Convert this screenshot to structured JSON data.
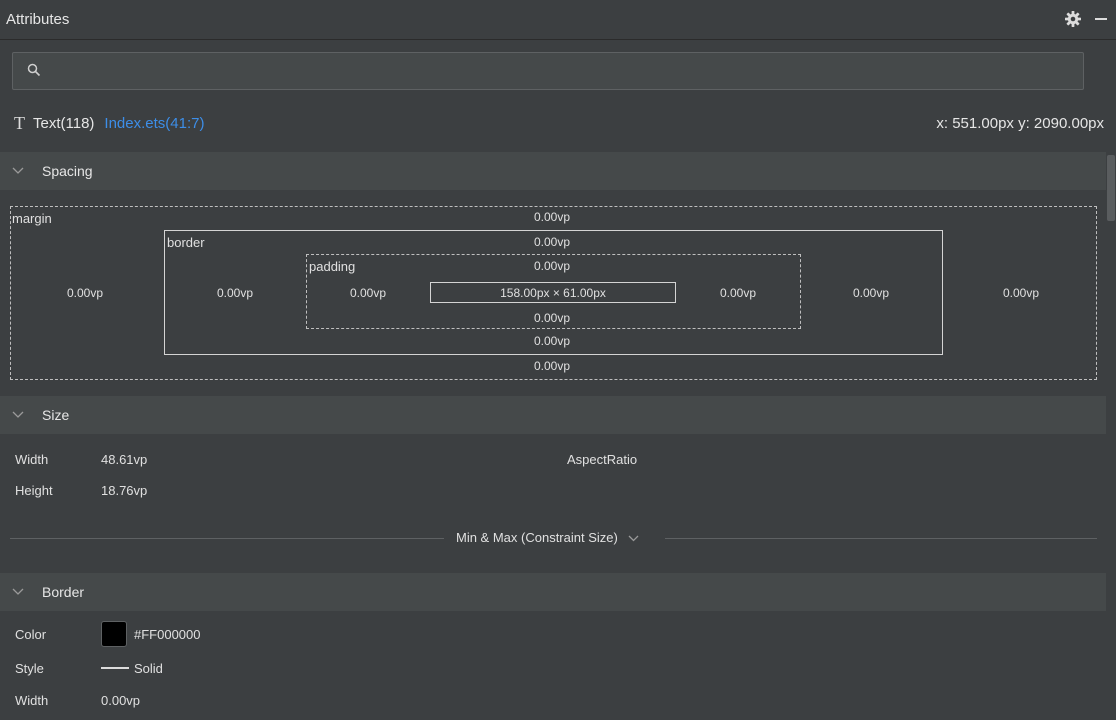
{
  "panel": {
    "title": "Attributes"
  },
  "search": {
    "placeholder": "",
    "value": ""
  },
  "component": {
    "type_icon": "T",
    "name": "Text(118)",
    "source_link": "Index.ets(41:7)",
    "coords": "x: 551.00px  y: 2090.00px"
  },
  "spacing": {
    "header": "Spacing",
    "margin": {
      "label": "margin",
      "top": "0.00vp",
      "bottom": "0.00vp",
      "left": "0.00vp",
      "right": "0.00vp"
    },
    "border": {
      "label": "border",
      "top": "0.00vp",
      "bottom": "0.00vp",
      "left": "0.00vp",
      "right": "0.00vp"
    },
    "padding": {
      "label": "padding",
      "top": "0.00vp",
      "bottom": "0.00vp",
      "left": "0.00vp",
      "right": "0.00vp"
    },
    "content": "158.00px × 61.00px"
  },
  "size": {
    "header": "Size",
    "width_label": "Width",
    "width_value": "48.61vp",
    "height_label": "Height",
    "height_value": "18.76vp",
    "aspect_label": "AspectRatio",
    "minmax_label": "Min & Max (Constraint Size)"
  },
  "border_section": {
    "header": "Border",
    "color_label": "Color",
    "color_value": "#FF000000",
    "style_label": "Style",
    "style_value": "Solid",
    "width_label": "Width",
    "width_value": "0.00vp"
  },
  "colors": {
    "link": "#3d8ee8",
    "background": "#3c3f41",
    "section": "#45494a"
  }
}
